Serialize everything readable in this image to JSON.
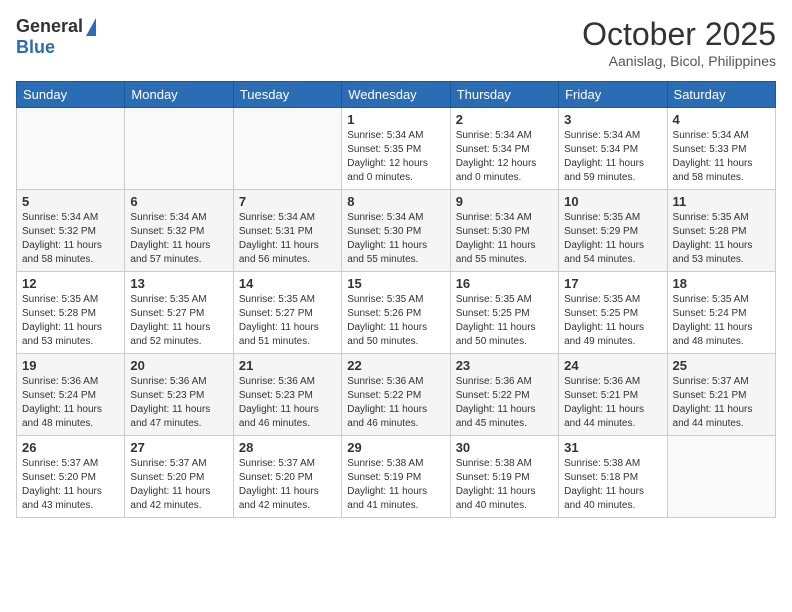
{
  "header": {
    "logo_general": "General",
    "logo_blue": "Blue",
    "month_title": "October 2025",
    "subtitle": "Aanislag, Bicol, Philippines"
  },
  "weekdays": [
    "Sunday",
    "Monday",
    "Tuesday",
    "Wednesday",
    "Thursday",
    "Friday",
    "Saturday"
  ],
  "weeks": [
    [
      {
        "day": "",
        "sunrise": "",
        "sunset": "",
        "daylight": ""
      },
      {
        "day": "",
        "sunrise": "",
        "sunset": "",
        "daylight": ""
      },
      {
        "day": "",
        "sunrise": "",
        "sunset": "",
        "daylight": ""
      },
      {
        "day": "1",
        "sunrise": "Sunrise: 5:34 AM",
        "sunset": "Sunset: 5:35 PM",
        "daylight": "Daylight: 12 hours and 0 minutes."
      },
      {
        "day": "2",
        "sunrise": "Sunrise: 5:34 AM",
        "sunset": "Sunset: 5:34 PM",
        "daylight": "Daylight: 12 hours and 0 minutes."
      },
      {
        "day": "3",
        "sunrise": "Sunrise: 5:34 AM",
        "sunset": "Sunset: 5:34 PM",
        "daylight": "Daylight: 11 hours and 59 minutes."
      },
      {
        "day": "4",
        "sunrise": "Sunrise: 5:34 AM",
        "sunset": "Sunset: 5:33 PM",
        "daylight": "Daylight: 11 hours and 58 minutes."
      }
    ],
    [
      {
        "day": "5",
        "sunrise": "Sunrise: 5:34 AM",
        "sunset": "Sunset: 5:32 PM",
        "daylight": "Daylight: 11 hours and 58 minutes."
      },
      {
        "day": "6",
        "sunrise": "Sunrise: 5:34 AM",
        "sunset": "Sunset: 5:32 PM",
        "daylight": "Daylight: 11 hours and 57 minutes."
      },
      {
        "day": "7",
        "sunrise": "Sunrise: 5:34 AM",
        "sunset": "Sunset: 5:31 PM",
        "daylight": "Daylight: 11 hours and 56 minutes."
      },
      {
        "day": "8",
        "sunrise": "Sunrise: 5:34 AM",
        "sunset": "Sunset: 5:30 PM",
        "daylight": "Daylight: 11 hours and 55 minutes."
      },
      {
        "day": "9",
        "sunrise": "Sunrise: 5:34 AM",
        "sunset": "Sunset: 5:30 PM",
        "daylight": "Daylight: 11 hours and 55 minutes."
      },
      {
        "day": "10",
        "sunrise": "Sunrise: 5:35 AM",
        "sunset": "Sunset: 5:29 PM",
        "daylight": "Daylight: 11 hours and 54 minutes."
      },
      {
        "day": "11",
        "sunrise": "Sunrise: 5:35 AM",
        "sunset": "Sunset: 5:28 PM",
        "daylight": "Daylight: 11 hours and 53 minutes."
      }
    ],
    [
      {
        "day": "12",
        "sunrise": "Sunrise: 5:35 AM",
        "sunset": "Sunset: 5:28 PM",
        "daylight": "Daylight: 11 hours and 53 minutes."
      },
      {
        "day": "13",
        "sunrise": "Sunrise: 5:35 AM",
        "sunset": "Sunset: 5:27 PM",
        "daylight": "Daylight: 11 hours and 52 minutes."
      },
      {
        "day": "14",
        "sunrise": "Sunrise: 5:35 AM",
        "sunset": "Sunset: 5:27 PM",
        "daylight": "Daylight: 11 hours and 51 minutes."
      },
      {
        "day": "15",
        "sunrise": "Sunrise: 5:35 AM",
        "sunset": "Sunset: 5:26 PM",
        "daylight": "Daylight: 11 hours and 50 minutes."
      },
      {
        "day": "16",
        "sunrise": "Sunrise: 5:35 AM",
        "sunset": "Sunset: 5:25 PM",
        "daylight": "Daylight: 11 hours and 50 minutes."
      },
      {
        "day": "17",
        "sunrise": "Sunrise: 5:35 AM",
        "sunset": "Sunset: 5:25 PM",
        "daylight": "Daylight: 11 hours and 49 minutes."
      },
      {
        "day": "18",
        "sunrise": "Sunrise: 5:35 AM",
        "sunset": "Sunset: 5:24 PM",
        "daylight": "Daylight: 11 hours and 48 minutes."
      }
    ],
    [
      {
        "day": "19",
        "sunrise": "Sunrise: 5:36 AM",
        "sunset": "Sunset: 5:24 PM",
        "daylight": "Daylight: 11 hours and 48 minutes."
      },
      {
        "day": "20",
        "sunrise": "Sunrise: 5:36 AM",
        "sunset": "Sunset: 5:23 PM",
        "daylight": "Daylight: 11 hours and 47 minutes."
      },
      {
        "day": "21",
        "sunrise": "Sunrise: 5:36 AM",
        "sunset": "Sunset: 5:23 PM",
        "daylight": "Daylight: 11 hours and 46 minutes."
      },
      {
        "day": "22",
        "sunrise": "Sunrise: 5:36 AM",
        "sunset": "Sunset: 5:22 PM",
        "daylight": "Daylight: 11 hours and 46 minutes."
      },
      {
        "day": "23",
        "sunrise": "Sunrise: 5:36 AM",
        "sunset": "Sunset: 5:22 PM",
        "daylight": "Daylight: 11 hours and 45 minutes."
      },
      {
        "day": "24",
        "sunrise": "Sunrise: 5:36 AM",
        "sunset": "Sunset: 5:21 PM",
        "daylight": "Daylight: 11 hours and 44 minutes."
      },
      {
        "day": "25",
        "sunrise": "Sunrise: 5:37 AM",
        "sunset": "Sunset: 5:21 PM",
        "daylight": "Daylight: 11 hours and 44 minutes."
      }
    ],
    [
      {
        "day": "26",
        "sunrise": "Sunrise: 5:37 AM",
        "sunset": "Sunset: 5:20 PM",
        "daylight": "Daylight: 11 hours and 43 minutes."
      },
      {
        "day": "27",
        "sunrise": "Sunrise: 5:37 AM",
        "sunset": "Sunset: 5:20 PM",
        "daylight": "Daylight: 11 hours and 42 minutes."
      },
      {
        "day": "28",
        "sunrise": "Sunrise: 5:37 AM",
        "sunset": "Sunset: 5:20 PM",
        "daylight": "Daylight: 11 hours and 42 minutes."
      },
      {
        "day": "29",
        "sunrise": "Sunrise: 5:38 AM",
        "sunset": "Sunset: 5:19 PM",
        "daylight": "Daylight: 11 hours and 41 minutes."
      },
      {
        "day": "30",
        "sunrise": "Sunrise: 5:38 AM",
        "sunset": "Sunset: 5:19 PM",
        "daylight": "Daylight: 11 hours and 40 minutes."
      },
      {
        "day": "31",
        "sunrise": "Sunrise: 5:38 AM",
        "sunset": "Sunset: 5:18 PM",
        "daylight": "Daylight: 11 hours and 40 minutes."
      },
      {
        "day": "",
        "sunrise": "",
        "sunset": "",
        "daylight": ""
      }
    ]
  ]
}
